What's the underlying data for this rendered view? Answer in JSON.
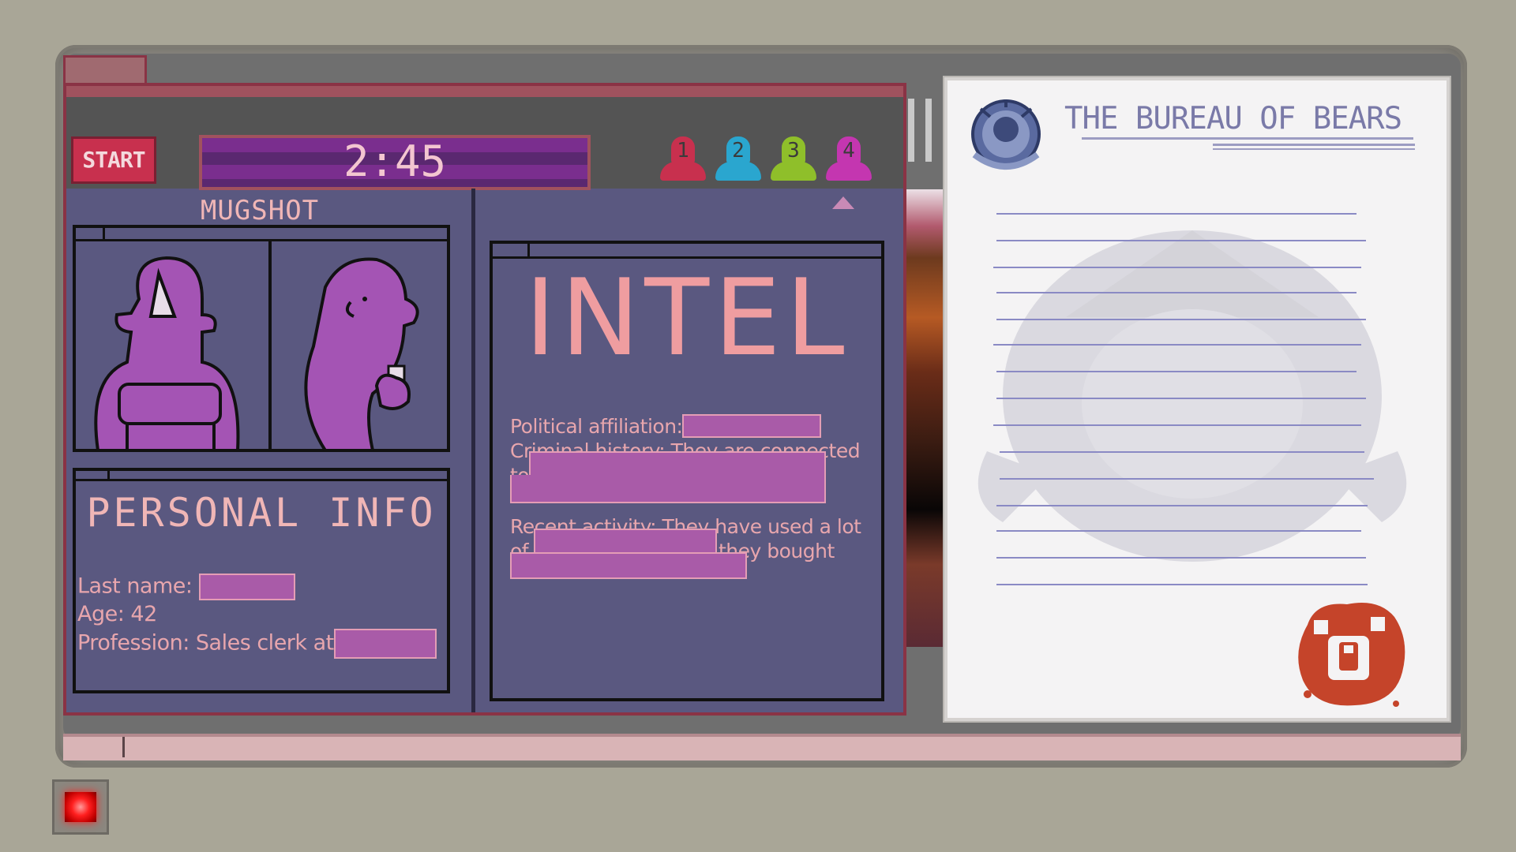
{
  "window": {
    "start_label": "START",
    "timer": "2:45"
  },
  "players": [
    {
      "number": "1",
      "color": "#c8304e"
    },
    {
      "number": "2",
      "color": "#2aa6cf"
    },
    {
      "number": "3",
      "color": "#8fbf2a"
    },
    {
      "number": "4",
      "color": "#c436b0"
    }
  ],
  "mugshot": {
    "title": "MUGSHOT"
  },
  "personal_info": {
    "title": "PERSONAL INFO",
    "last_name_label": "Last name:",
    "age_label": "Age: 42",
    "profession_label": "Profession: Sales clerk at"
  },
  "intel": {
    "title": "INTEL",
    "political_label": "Political affiliation:",
    "criminal_label": "Criminal history: They are connected to",
    "recent_label_a": "Recent activity: They have used a lot of",
    "recent_label_b": "they bought"
  },
  "paper": {
    "title": "THE BUREAU OF BEARS"
  },
  "colors": {
    "accent": "#8a3345",
    "panel": "#5a5880",
    "text": "#e8a6ad",
    "blank_fill": "#a95ba8",
    "paper_ink": "#7a7aa8"
  }
}
